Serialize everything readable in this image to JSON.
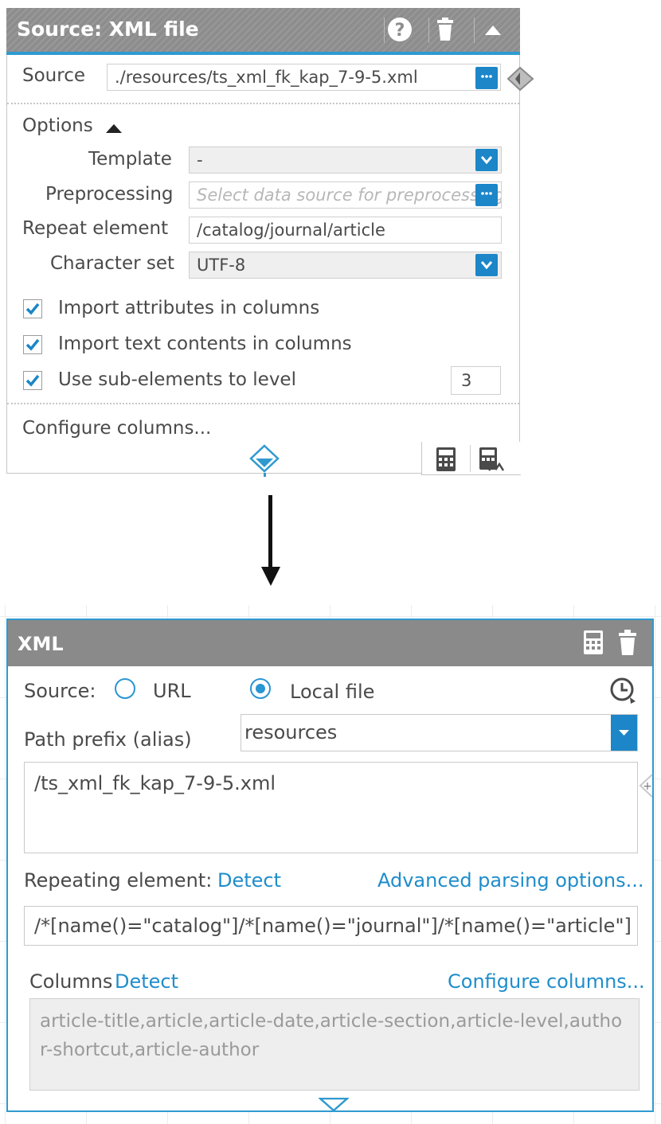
{
  "colors": {
    "accent": "#2f9ad0",
    "header_bg": "#8d8d8d",
    "link": "#1f8dcb",
    "button": "#1c86c8"
  },
  "panel1": {
    "title": "Source: XML file",
    "header_icons": [
      "help-icon",
      "trash-icon",
      "collapse-up-icon"
    ],
    "source_label": "Source",
    "source_value": "./resources/ts_xml_fk_kap_7-9-5.xml",
    "options_label": "Options",
    "template_label": "Template",
    "template_value": "-",
    "preprocessing_label": "Preprocessing",
    "preprocessing_placeholder": "Select data source for preprocessing",
    "repeat_label": "Repeat element",
    "repeat_value": "/catalog/journal/article",
    "charset_label": "Character set",
    "charset_value": "UTF-8",
    "check_attributes": "Import attributes in columns",
    "check_text": "Import text contents in columns",
    "check_subelements": "Use sub-elements to level",
    "level_value": "3",
    "configure_columns": "Configure columns...",
    "footer_icons": [
      "calculator-icon",
      "calculator-chart-icon"
    ]
  },
  "panel2": {
    "title": "XML",
    "header_icons": [
      "calculator-icon",
      "trash-icon"
    ],
    "source_label": "Source:",
    "radio_url": "URL",
    "radio_local": "Local file",
    "selected_source": "Local file",
    "prefix_label": "Path prefix (alias)",
    "prefix_value": "resources",
    "path_value": "/ts_xml_fk_kap_7-9-5.xml",
    "repeating_label": "Repeating element:",
    "detect": "Detect",
    "advanced": "Advanced parsing options...",
    "repeating_value": "/*[name()=\"catalog\"]/*[name()=\"journal\"]/*[name()=\"article\"]",
    "columns_label": "Columns",
    "columns_detect": "Detect",
    "configure_columns": "Configure columns...",
    "columns_value": "article-title,article,article-date,article-section,article-level,author-shortcut,article-author"
  }
}
